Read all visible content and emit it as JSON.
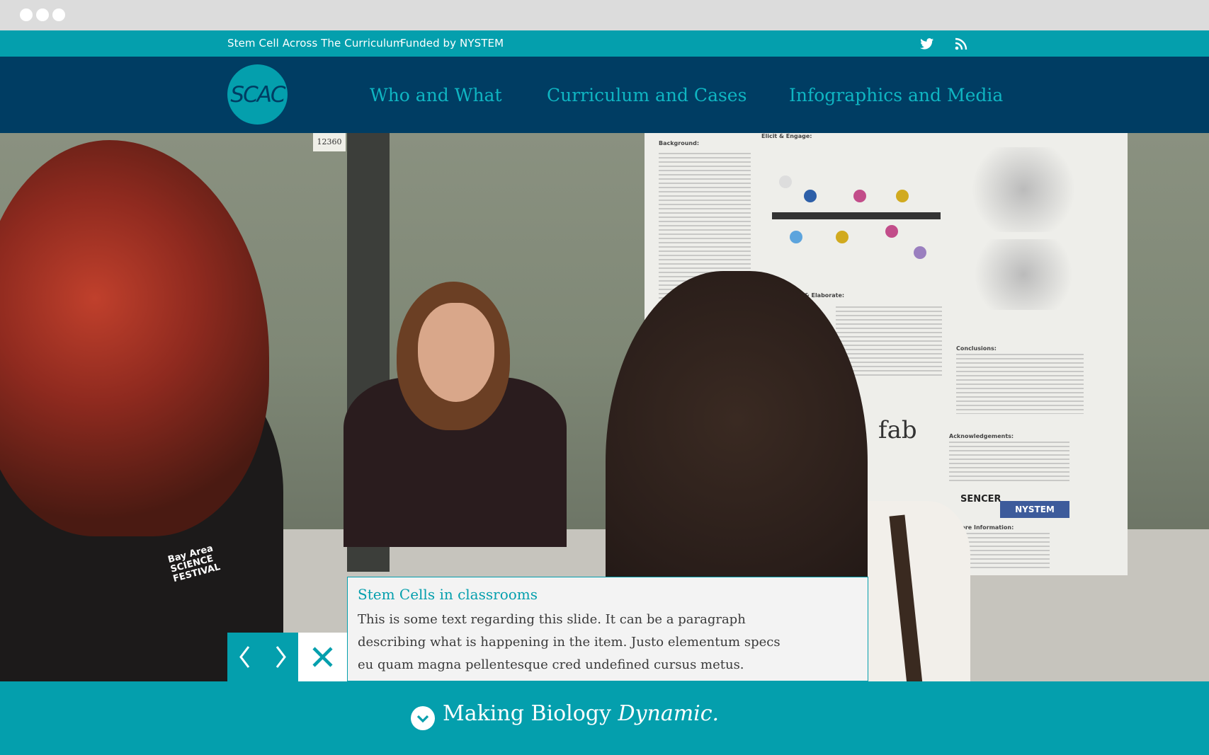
{
  "topbar": {
    "site_link": "Stem Cell Across The Curriculum",
    "funded_link": "Funded by NYSTEM",
    "icons": [
      "twitter-icon",
      "rss-icon"
    ]
  },
  "navbar": {
    "logo_text": "SCAC",
    "items": [
      {
        "label": "Who and What"
      },
      {
        "label": "Curriculum and Cases"
      },
      {
        "label": "Infographics and Media"
      }
    ]
  },
  "hero": {
    "tag_number": "12360",
    "poster_sections": [
      "Background:",
      "Elicit & Engage:",
      "Explain & Elaborate:",
      "Conclusions:",
      "Acknowledgements:",
      "For More Information:"
    ],
    "poster_sponsors": [
      "SENCER",
      "NYSTEM"
    ],
    "poster_fab": "fab",
    "shirt_logo": [
      "Bay Area",
      "SCIENCE",
      "FESTIVAL"
    ]
  },
  "slide": {
    "title": "Stem Cells in classrooms",
    "text": "This is some text regarding this slide. It can be a paragraph describing what is  happening in the item. Justo elementum specs eu quam magna pellentesque cred undefined cursus metus."
  },
  "footer": {
    "text_plain": "Making Biology ",
    "text_emph": "Dynamic."
  },
  "colors": {
    "teal": "#049fad",
    "navy": "#003d63",
    "chrome": "#dcdcdc"
  }
}
